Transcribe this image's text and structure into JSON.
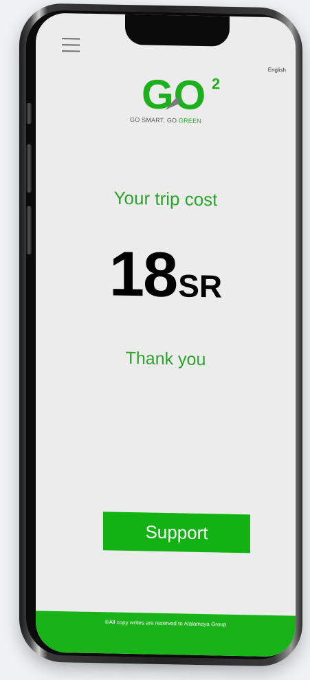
{
  "language": "English",
  "brand": {
    "logo_text": "GO",
    "superscript": "2",
    "tagline_start": "GO SMART, GO ",
    "tagline_highlight": "GREEN"
  },
  "trip": {
    "label": "Your trip cost",
    "amount": "18",
    "currency": "SR",
    "thanks": "Thank you"
  },
  "support": {
    "label": "Support"
  },
  "footer": {
    "copyright": "©All copy writes are reserved to Alalamaya Group"
  },
  "colors": {
    "accent_green": "#12b212",
    "text_green": "#2aa52a",
    "screen_bg": "#ececec",
    "phone_frame": "#222222"
  },
  "icons": [
    "hamburger-menu-icon",
    "go-logo-icon"
  ]
}
